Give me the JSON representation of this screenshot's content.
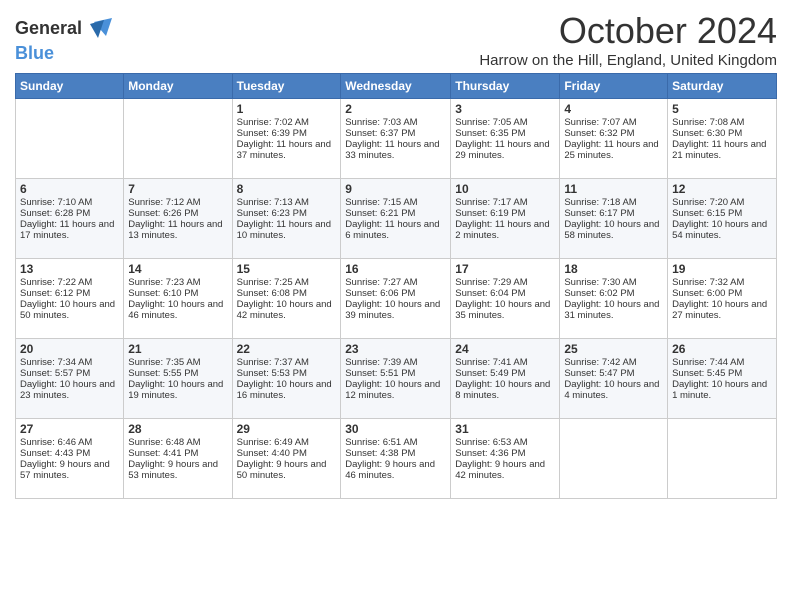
{
  "logo": {
    "line1": "General",
    "line2": "Blue"
  },
  "title": "October 2024",
  "subtitle": "Harrow on the Hill, England, United Kingdom",
  "days_of_week": [
    "Sunday",
    "Monday",
    "Tuesday",
    "Wednesday",
    "Thursday",
    "Friday",
    "Saturday"
  ],
  "weeks": [
    [
      {
        "day": "",
        "text": ""
      },
      {
        "day": "",
        "text": ""
      },
      {
        "day": "1",
        "text": "Sunrise: 7:02 AM\nSunset: 6:39 PM\nDaylight: 11 hours and 37 minutes."
      },
      {
        "day": "2",
        "text": "Sunrise: 7:03 AM\nSunset: 6:37 PM\nDaylight: 11 hours and 33 minutes."
      },
      {
        "day": "3",
        "text": "Sunrise: 7:05 AM\nSunset: 6:35 PM\nDaylight: 11 hours and 29 minutes."
      },
      {
        "day": "4",
        "text": "Sunrise: 7:07 AM\nSunset: 6:32 PM\nDaylight: 11 hours and 25 minutes."
      },
      {
        "day": "5",
        "text": "Sunrise: 7:08 AM\nSunset: 6:30 PM\nDaylight: 11 hours and 21 minutes."
      }
    ],
    [
      {
        "day": "6",
        "text": "Sunrise: 7:10 AM\nSunset: 6:28 PM\nDaylight: 11 hours and 17 minutes."
      },
      {
        "day": "7",
        "text": "Sunrise: 7:12 AM\nSunset: 6:26 PM\nDaylight: 11 hours and 13 minutes."
      },
      {
        "day": "8",
        "text": "Sunrise: 7:13 AM\nSunset: 6:23 PM\nDaylight: 11 hours and 10 minutes."
      },
      {
        "day": "9",
        "text": "Sunrise: 7:15 AM\nSunset: 6:21 PM\nDaylight: 11 hours and 6 minutes."
      },
      {
        "day": "10",
        "text": "Sunrise: 7:17 AM\nSunset: 6:19 PM\nDaylight: 11 hours and 2 minutes."
      },
      {
        "day": "11",
        "text": "Sunrise: 7:18 AM\nSunset: 6:17 PM\nDaylight: 10 hours and 58 minutes."
      },
      {
        "day": "12",
        "text": "Sunrise: 7:20 AM\nSunset: 6:15 PM\nDaylight: 10 hours and 54 minutes."
      }
    ],
    [
      {
        "day": "13",
        "text": "Sunrise: 7:22 AM\nSunset: 6:12 PM\nDaylight: 10 hours and 50 minutes."
      },
      {
        "day": "14",
        "text": "Sunrise: 7:23 AM\nSunset: 6:10 PM\nDaylight: 10 hours and 46 minutes."
      },
      {
        "day": "15",
        "text": "Sunrise: 7:25 AM\nSunset: 6:08 PM\nDaylight: 10 hours and 42 minutes."
      },
      {
        "day": "16",
        "text": "Sunrise: 7:27 AM\nSunset: 6:06 PM\nDaylight: 10 hours and 39 minutes."
      },
      {
        "day": "17",
        "text": "Sunrise: 7:29 AM\nSunset: 6:04 PM\nDaylight: 10 hours and 35 minutes."
      },
      {
        "day": "18",
        "text": "Sunrise: 7:30 AM\nSunset: 6:02 PM\nDaylight: 10 hours and 31 minutes."
      },
      {
        "day": "19",
        "text": "Sunrise: 7:32 AM\nSunset: 6:00 PM\nDaylight: 10 hours and 27 minutes."
      }
    ],
    [
      {
        "day": "20",
        "text": "Sunrise: 7:34 AM\nSunset: 5:57 PM\nDaylight: 10 hours and 23 minutes."
      },
      {
        "day": "21",
        "text": "Sunrise: 7:35 AM\nSunset: 5:55 PM\nDaylight: 10 hours and 19 minutes."
      },
      {
        "day": "22",
        "text": "Sunrise: 7:37 AM\nSunset: 5:53 PM\nDaylight: 10 hours and 16 minutes."
      },
      {
        "day": "23",
        "text": "Sunrise: 7:39 AM\nSunset: 5:51 PM\nDaylight: 10 hours and 12 minutes."
      },
      {
        "day": "24",
        "text": "Sunrise: 7:41 AM\nSunset: 5:49 PM\nDaylight: 10 hours and 8 minutes."
      },
      {
        "day": "25",
        "text": "Sunrise: 7:42 AM\nSunset: 5:47 PM\nDaylight: 10 hours and 4 minutes."
      },
      {
        "day": "26",
        "text": "Sunrise: 7:44 AM\nSunset: 5:45 PM\nDaylight: 10 hours and 1 minute."
      }
    ],
    [
      {
        "day": "27",
        "text": "Sunrise: 6:46 AM\nSunset: 4:43 PM\nDaylight: 9 hours and 57 minutes."
      },
      {
        "day": "28",
        "text": "Sunrise: 6:48 AM\nSunset: 4:41 PM\nDaylight: 9 hours and 53 minutes."
      },
      {
        "day": "29",
        "text": "Sunrise: 6:49 AM\nSunset: 4:40 PM\nDaylight: 9 hours and 50 minutes."
      },
      {
        "day": "30",
        "text": "Sunrise: 6:51 AM\nSunset: 4:38 PM\nDaylight: 9 hours and 46 minutes."
      },
      {
        "day": "31",
        "text": "Sunrise: 6:53 AM\nSunset: 4:36 PM\nDaylight: 9 hours and 42 minutes."
      },
      {
        "day": "",
        "text": ""
      },
      {
        "day": "",
        "text": ""
      }
    ]
  ]
}
